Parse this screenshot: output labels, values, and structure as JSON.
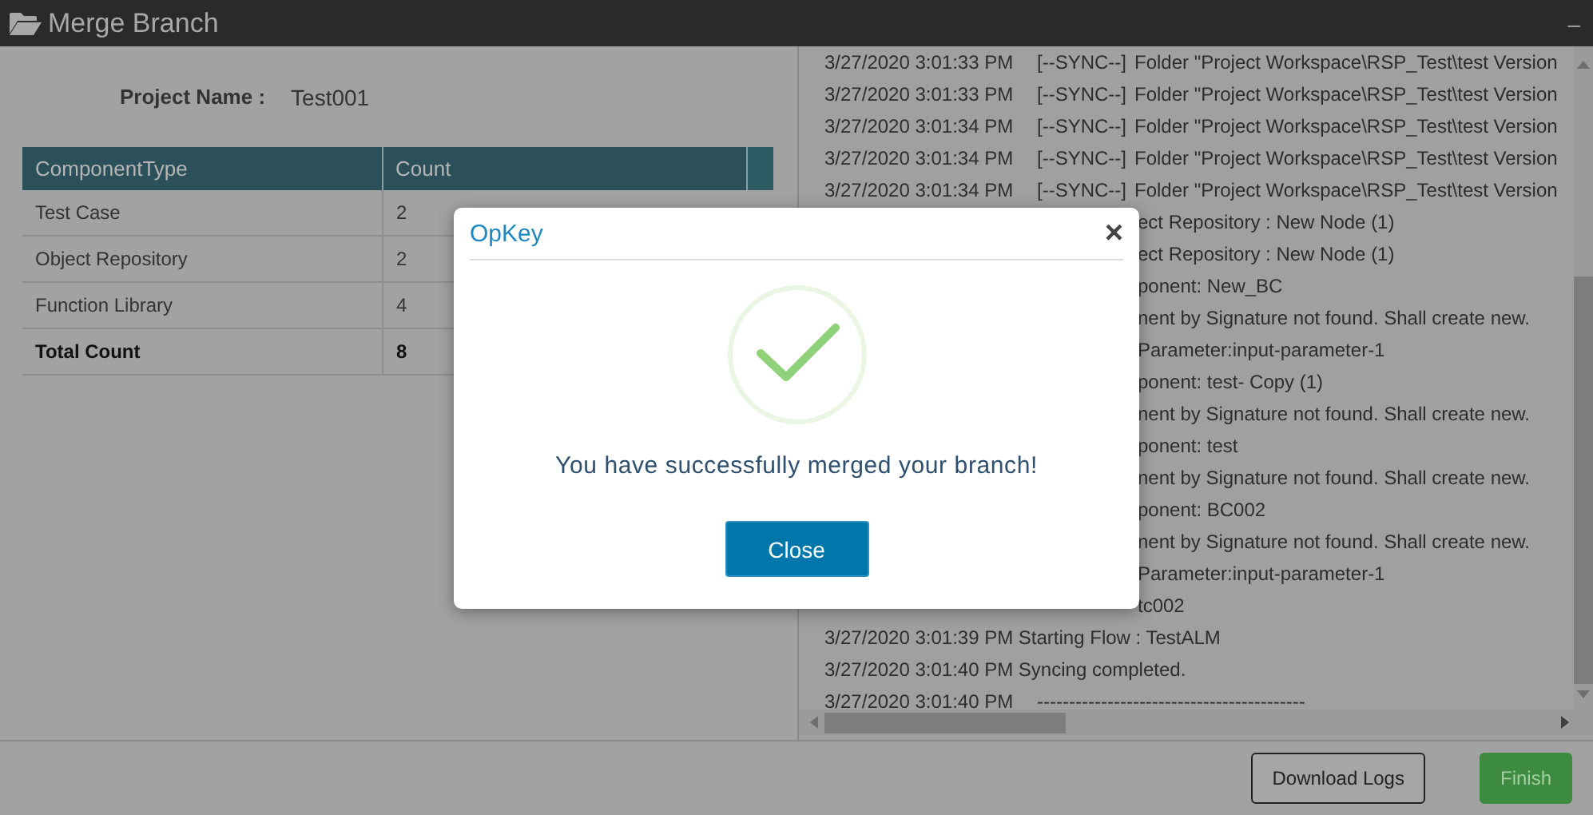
{
  "window": {
    "title": "Merge Branch",
    "minimize": "–"
  },
  "project": {
    "label": "Project Name :",
    "value": "Test001"
  },
  "table": {
    "columns": [
      "ComponentType",
      "Count"
    ],
    "rows": [
      {
        "type": "Test Case",
        "count": "2",
        "kind": "normal"
      },
      {
        "type": "Object Repository",
        "count": "2",
        "kind": "normal"
      },
      {
        "type": "Function Library",
        "count": "4",
        "kind": "normal"
      },
      {
        "type": "Total Count",
        "count": "8",
        "kind": "total"
      }
    ]
  },
  "log": [
    {
      "kind": "sync",
      "time": "3/27/2020 3:01:33 PM",
      "tag": "[--SYNC--]",
      "text": "Folder \"Project Workspace\\RSP_Test\\test Version"
    },
    {
      "kind": "sync",
      "time": "3/27/2020 3:01:33 PM",
      "tag": "[--SYNC--]",
      "text": "Folder \"Project Workspace\\RSP_Test\\test Version"
    },
    {
      "kind": "sync",
      "time": "3/27/2020 3:01:34 PM",
      "tag": "[--SYNC--]",
      "text": "Folder \"Project Workspace\\RSP_Test\\test Version"
    },
    {
      "kind": "sync",
      "time": "3/27/2020 3:01:34 PM",
      "tag": "[--SYNC--]",
      "text": "Folder \"Project Workspace\\RSP_Test\\test Version"
    },
    {
      "kind": "sync",
      "time": "3/27/2020 3:01:34 PM",
      "tag": "[--SYNC--]",
      "text": "Folder \"Project Workspace\\RSP_Test\\test Version"
    },
    {
      "kind": "partial",
      "text": "ect Repository : New Node (1)"
    },
    {
      "kind": "partial",
      "text": "ect Repository : New Node (1)"
    },
    {
      "kind": "partial",
      "text": "ponent: New_BC"
    },
    {
      "kind": "partial",
      "text": "nent by Signature not found. Shall create new."
    },
    {
      "kind": "partial",
      "text": "Parameter:input-parameter-1"
    },
    {
      "kind": "partial",
      "text": "ponent: test- Copy (1)"
    },
    {
      "kind": "partial",
      "text": "nent by Signature not found. Shall create new."
    },
    {
      "kind": "partial",
      "text": "ponent: test"
    },
    {
      "kind": "partial",
      "text": "nent by Signature not found. Shall create new."
    },
    {
      "kind": "partial",
      "text": "ponent: BC002"
    },
    {
      "kind": "partial",
      "text": "nent by Signature not found. Shall create new."
    },
    {
      "kind": "partial",
      "text": "Parameter:input-parameter-1"
    },
    {
      "kind": "partial",
      "text": "tc002"
    },
    {
      "kind": "plain",
      "text": "3/27/2020 3:01:39 PM Starting Flow : TestALM"
    },
    {
      "kind": "plain",
      "text": "3/27/2020 3:01:40 PM Syncing completed."
    },
    {
      "kind": "sync",
      "time": "3/27/2020 3:01:40 PM",
      "tag": "------------------------------------------"
    }
  ],
  "footer": {
    "buttons": [
      {
        "label": "Download Logs",
        "kind": "outline"
      },
      {
        "label": "Finish",
        "kind": "primary"
      }
    ]
  },
  "dialog": {
    "title": "OpKey",
    "close": "×",
    "message": "You have successfully merged your branch!",
    "button": "Close"
  }
}
